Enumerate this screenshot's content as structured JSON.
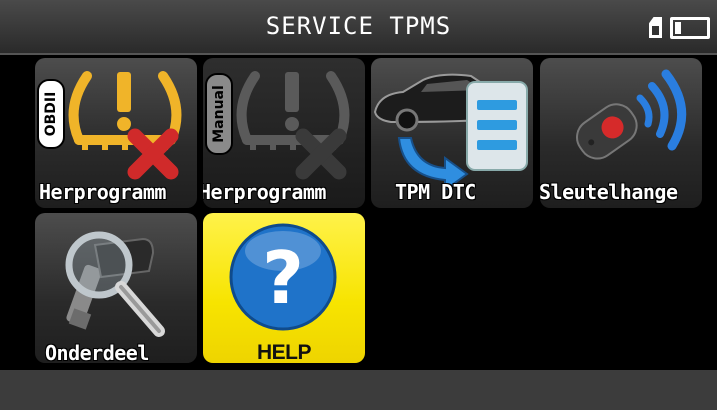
{
  "header": {
    "title": "SERVICE  TPMS",
    "icons": {
      "sd_card": "sd-card-icon",
      "battery": "battery-icon"
    }
  },
  "menu": {
    "items": [
      {
        "label": "Herprogramm",
        "icon": "tpms-obdii-error-icon",
        "badge": "OBDII"
      },
      {
        "label": "Herprogramm",
        "icon": "tpms-manual-disabled-icon",
        "badge": "Manual"
      },
      {
        "label": "TPM  DTC",
        "icon": "car-dtc-list-icon"
      },
      {
        "label": "Sleutelhange",
        "icon": "key-fob-signal-icon"
      },
      {
        "label": "Onderdeel",
        "icon": "sensor-magnifier-icon"
      },
      {
        "label": "HELP",
        "icon": "help-question-icon"
      }
    ]
  },
  "colors": {
    "help_tile": "#f7e400",
    "tpms_yellow": "#f0b429",
    "error_red": "#d02a2a",
    "help_blue": "#1f73c9"
  }
}
